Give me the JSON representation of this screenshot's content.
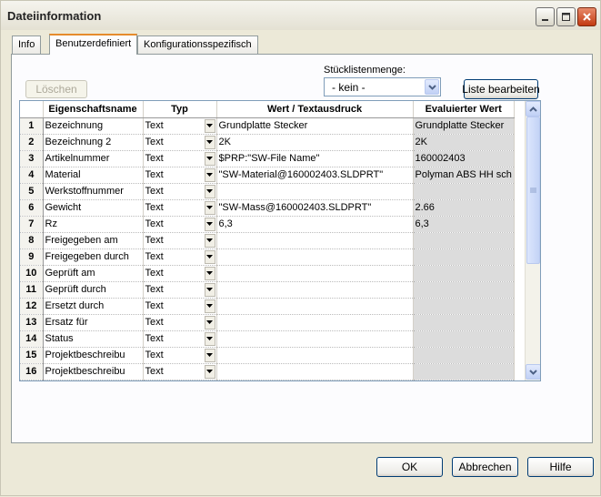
{
  "window": {
    "title": "Dateiinformation"
  },
  "tabs": [
    {
      "label": "Info"
    },
    {
      "label": "Benutzerdefiniert"
    },
    {
      "label": "Konfigurationsspezifisch"
    }
  ],
  "toolbar": {
    "delete_label": "Löschen",
    "bom_label": "Stücklistenmenge:",
    "bom_value": "- kein -",
    "edit_list_label": "Liste bearbeiten"
  },
  "table": {
    "headers": [
      "Eigenschaftsname",
      "Typ",
      "Wert / Textausdruck",
      "Evaluierter Wert"
    ],
    "rows": [
      {
        "num": "1",
        "name": "Bezeichnung",
        "type": "Text",
        "value": "Grundplatte Stecker",
        "evaluated": "Grundplatte Stecker"
      },
      {
        "num": "2",
        "name": "Bezeichnung 2",
        "type": "Text",
        "value": "2K",
        "evaluated": "2K"
      },
      {
        "num": "3",
        "name": "Artikelnummer",
        "type": "Text",
        "value": "$PRP:\"SW-File Name\"",
        "evaluated": "160002403"
      },
      {
        "num": "4",
        "name": "Material",
        "type": "Text",
        "value": "\"SW-Material@160002403.SLDPRT\"",
        "evaluated": "Polyman ABS HH sch"
      },
      {
        "num": "5",
        "name": "Werkstoffnummer",
        "type": "Text",
        "value": "",
        "evaluated": ""
      },
      {
        "num": "6",
        "name": "Gewicht",
        "type": "Text",
        "value": "\"SW-Mass@160002403.SLDPRT\"",
        "evaluated": "2.66"
      },
      {
        "num": "7",
        "name": "Rz",
        "type": "Text",
        "value": "6,3",
        "evaluated": "6,3"
      },
      {
        "num": "8",
        "name": "Freigegeben am",
        "type": "Text",
        "value": "",
        "evaluated": ""
      },
      {
        "num": "9",
        "name": "Freigegeben durch",
        "type": "Text",
        "value": "",
        "evaluated": ""
      },
      {
        "num": "10",
        "name": "Geprüft am",
        "type": "Text",
        "value": "",
        "evaluated": ""
      },
      {
        "num": "11",
        "name": "Geprüft durch",
        "type": "Text",
        "value": "",
        "evaluated": ""
      },
      {
        "num": "12",
        "name": "Ersetzt durch",
        "type": "Text",
        "value": "",
        "evaluated": ""
      },
      {
        "num": "13",
        "name": "Ersatz für",
        "type": "Text",
        "value": "",
        "evaluated": ""
      },
      {
        "num": "14",
        "name": "Status",
        "type": "Text",
        "value": "",
        "evaluated": ""
      },
      {
        "num": "15",
        "name": "Projektbeschreibu",
        "type": "Text",
        "value": "",
        "evaluated": ""
      },
      {
        "num": "16",
        "name": "Projektbeschreibu",
        "type": "Text",
        "value": "",
        "evaluated": ""
      }
    ]
  },
  "footer": {
    "ok_label": "OK",
    "cancel_label": "Abbrechen",
    "help_label": "Hilfe"
  }
}
